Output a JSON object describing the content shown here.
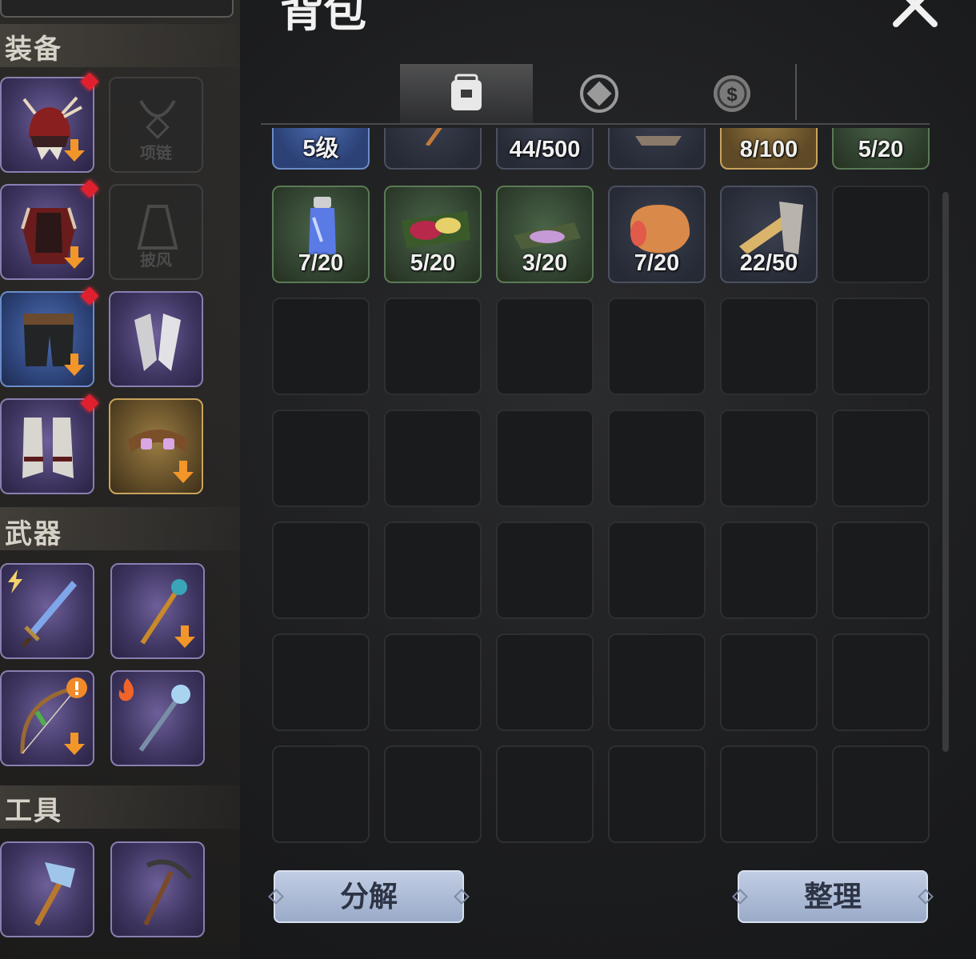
{
  "header": {
    "title": "背包"
  },
  "sections": {
    "equipment": "装备",
    "weapons": "武器",
    "tools": "工具"
  },
  "equipment": {
    "necklace_label": "项链",
    "cloak_label": "披风"
  },
  "tabs": [
    {
      "icon": "backpack-icon",
      "active": true
    },
    {
      "icon": "gem-icon",
      "active": false
    },
    {
      "icon": "coin-icon",
      "active": false
    }
  ],
  "inventory": {
    "row1": [
      "5级",
      "",
      "44/500",
      "",
      "8/100",
      "5/20"
    ],
    "row2": [
      "7/20",
      "5/20",
      "3/20",
      "7/20",
      "22/50",
      ""
    ]
  },
  "buttons": {
    "decompose": "分解",
    "sort": "整理"
  },
  "colors": {
    "accent_gold": "#c9a35c",
    "notify_red": "#e0202e",
    "button_blue": "#aebbd8"
  }
}
